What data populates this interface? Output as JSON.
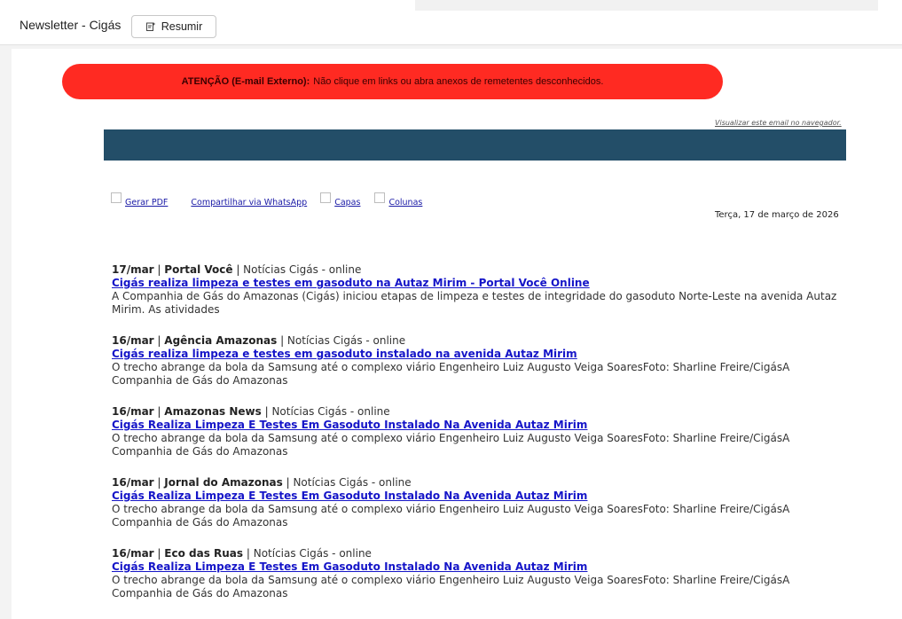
{
  "header": {
    "subject": "Newsletter - Cigás",
    "resumir_label": "Resumir"
  },
  "warning": {
    "bold": "ATENÇÃO (E-mail Externo):",
    "text": "Não clique em links ou abra anexos de remetentes desconhecidos."
  },
  "view_in_browser": "Visualizar este email no navegador.",
  "tools": {
    "pdf": "Gerar PDF",
    "whatsapp": "Compartilhar via WhatsApp",
    "capas": "Capas",
    "colunas": "Colunas"
  },
  "date": "Terça, 17 de março de 2026",
  "news": [
    {
      "date": "17/mar",
      "source": "Portal Você",
      "category": "Notícias Cigás - online",
      "title": "Cigás realiza limpeza e testes em gasoduto na Autaz Mirim - Portal Você Online",
      "excerpt": "A Companhia de Gás do Amazonas (Cigás) iniciou etapas de limpeza e testes de integridade do gasoduto Norte-Leste na avenida Autaz Mirim. As atividades"
    },
    {
      "date": "16/mar",
      "source": "Agência Amazonas",
      "category": "Notícias Cigás - online",
      "title": "Cigás realiza limpeza e testes em gasoduto instalado na avenida Autaz Mirim",
      "excerpt": "O trecho abrange da bola da Samsung até o complexo viário Engenheiro Luiz Augusto Veiga SoaresFoto: Sharline Freire/CigásA Companhia de Gás do Amazonas"
    },
    {
      "date": "16/mar",
      "source": "Amazonas News",
      "category": "Notícias Cigás - online",
      "title": "Cigás Realiza Limpeza E Testes Em Gasoduto Instalado Na Avenida Autaz Mirim",
      "excerpt": "O trecho abrange da bola da Samsung até o complexo viário Engenheiro Luiz Augusto Veiga SoaresFoto: Sharline Freire/CigásA Companhia de Gás do Amazonas"
    },
    {
      "date": "16/mar",
      "source": "Jornal do Amazonas",
      "category": "Notícias Cigás - online",
      "title": "Cigás Realiza Limpeza E Testes Em Gasoduto Instalado Na Avenida Autaz Mirim",
      "excerpt": "O trecho abrange da bola da Samsung até o complexo viário Engenheiro Luiz Augusto Veiga SoaresFoto: Sharline Freire/CigásA Companhia de Gás do Amazonas"
    },
    {
      "date": "16/mar",
      "source": "Eco das Ruas",
      "category": "Notícias Cigás - online",
      "title": "Cigás Realiza Limpeza E Testes Em Gasoduto Instalado Na Avenida Autaz Mirim",
      "excerpt": "O trecho abrange da bola da Samsung até o complexo viário Engenheiro Luiz Augusto Veiga SoaresFoto: Sharline Freire/CigásA Companhia de Gás do Amazonas"
    }
  ],
  "colors": {
    "warning_bg": "#ff2a22",
    "banner_bg": "#234e68",
    "link": "#1515c8"
  }
}
